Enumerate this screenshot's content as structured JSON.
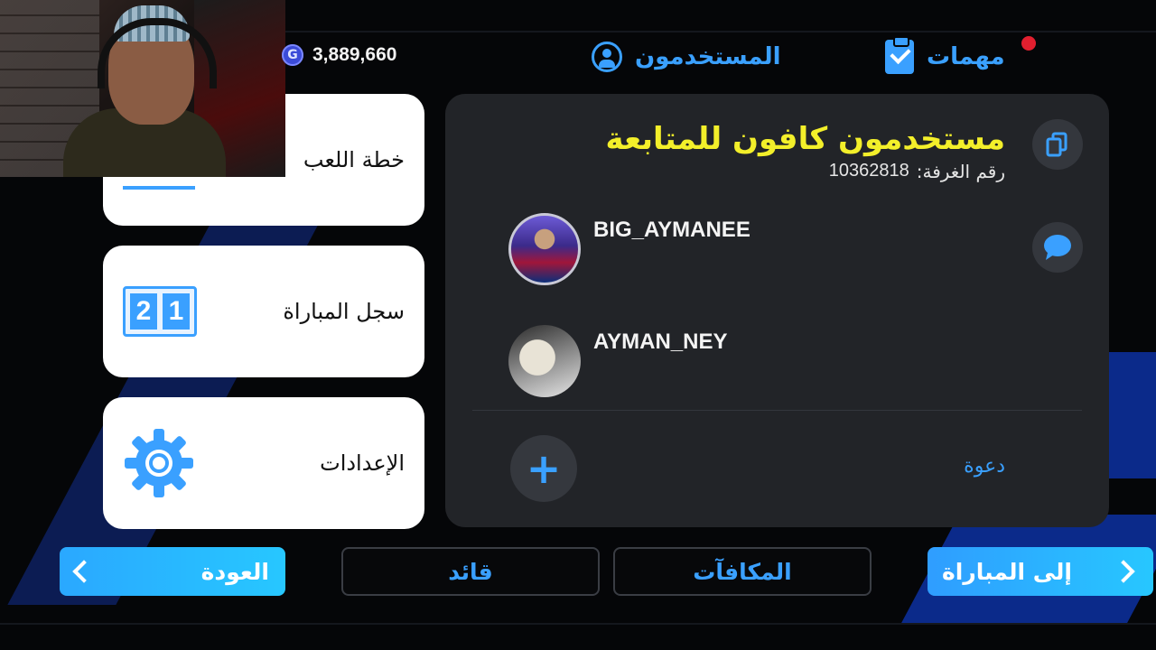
{
  "header": {
    "coins": "3,889,660",
    "users_label": "المستخدمون",
    "tasks_label": "مهمات"
  },
  "menu": {
    "items": [
      {
        "label": "خطة اللعب",
        "icon": "formation-icon"
      },
      {
        "label": "سجل المباراة",
        "icon": "scoreboard-icon",
        "score_left": "2",
        "score_right": "1"
      },
      {
        "label": "الإعدادات",
        "icon": "gear-icon"
      }
    ]
  },
  "room": {
    "title": "مستخدمون كافون للمتابعة",
    "room_label": "رقم الغرفة:",
    "room_number": "10362818",
    "players": [
      {
        "name": "BIG_AYMANEE"
      },
      {
        "name": "AYMAN_NEY"
      }
    ],
    "invite_label": "دعوة"
  },
  "footer": {
    "back_label": "العودة",
    "captain_label": "قائد",
    "rewards_label": "المكافآت",
    "match_label": "إلى المباراة"
  },
  "colors": {
    "accent": "#3aa0ff",
    "title_yellow": "#f3ef2a",
    "panel": "#222428",
    "notification": "#e21f2f"
  }
}
